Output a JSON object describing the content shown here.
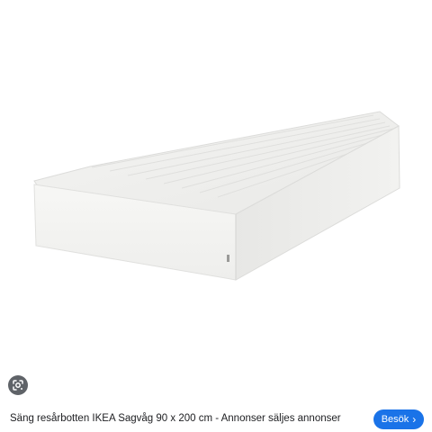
{
  "product_image": {
    "icon": "mattress-image"
  },
  "lens": {
    "icon": "google-lens-icon"
  },
  "caption": {
    "text": "Säng resårbotten IKEA Sagvåg 90 x 200 cm - Annonser säljes annonser"
  },
  "visit_button": {
    "label": "Besök",
    "icon": "chevron-right-icon",
    "chevron": "›",
    "color": "#1a73e8"
  }
}
